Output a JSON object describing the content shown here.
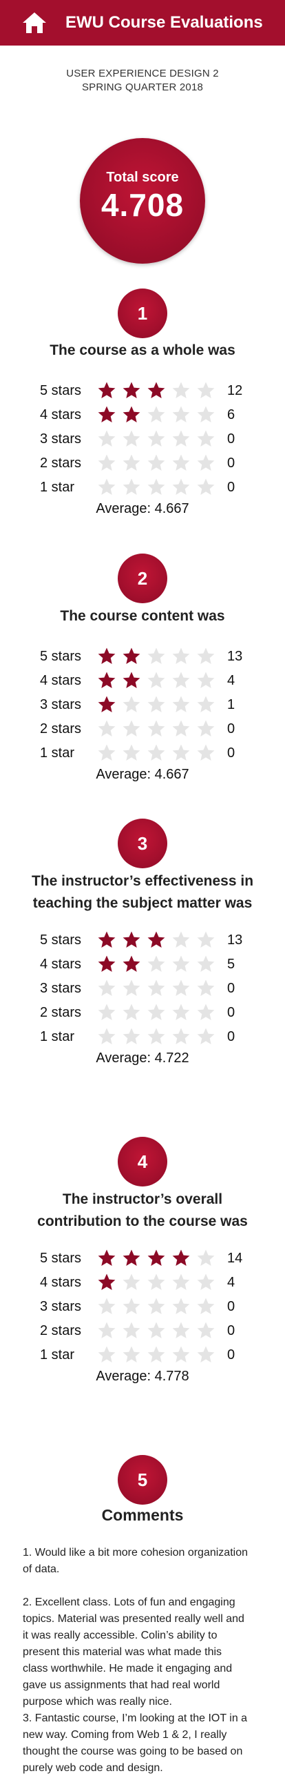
{
  "header": {
    "title": "EWU Course Evaluations",
    "color": "#a30f2d"
  },
  "course": {
    "name": "USER EXPERIENCE DESIGN 2",
    "term": "SPRING QUARTER 2018"
  },
  "total": {
    "label": "Total score",
    "value": "4.708"
  },
  "colors": {
    "star_filled": "#8c0a26",
    "star_empty": "#e4e4e4"
  },
  "questions": [
    {
      "number": "1",
      "title": "The course as a whole was",
      "ratings": [
        {
          "label": "5 stars",
          "count": "12",
          "filled": 3
        },
        {
          "label": "4 stars",
          "count": "6",
          "filled": 2
        },
        {
          "label": "3 stars",
          "count": "0",
          "filled": 0
        },
        {
          "label": "2 stars",
          "count": "0",
          "filled": 0
        },
        {
          "label": "1 star",
          "count": "0",
          "filled": 0
        }
      ],
      "average": "Average: 4.667"
    },
    {
      "number": "2",
      "title": "The course content was",
      "ratings": [
        {
          "label": "5 stars",
          "count": "13",
          "filled": 2
        },
        {
          "label": "4 stars",
          "count": "4",
          "filled": 2
        },
        {
          "label": "3 stars",
          "count": "1",
          "filled": 1
        },
        {
          "label": "2 stars",
          "count": "0",
          "filled": 0
        },
        {
          "label": "1 star",
          "count": "0",
          "filled": 0
        }
      ],
      "average": "Average: 4.667"
    },
    {
      "number": "3",
      "title_line1": "The instructor’s effectiveness in",
      "title_line2": "teaching the subject matter was",
      "ratings": [
        {
          "label": "5 stars",
          "count": "13",
          "filled": 3
        },
        {
          "label": "4 stars",
          "count": "5",
          "filled": 2
        },
        {
          "label": "3 stars",
          "count": "0",
          "filled": 0
        },
        {
          "label": "2 stars",
          "count": "0",
          "filled": 0
        },
        {
          "label": "1 star",
          "count": "0",
          "filled": 0
        }
      ],
      "average": "Average: 4.722"
    },
    {
      "number": "4",
      "title_line1": "The instructor’s overall",
      "title_line2": "contribution to the course was",
      "ratings": [
        {
          "label": "5 stars",
          "count": "14",
          "filled": 4
        },
        {
          "label": "4 stars",
          "count": "4",
          "filled": 1
        },
        {
          "label": "3 stars",
          "count": "0",
          "filled": 0
        },
        {
          "label": "2 stars",
          "count": "0",
          "filled": 0
        },
        {
          "label": "1 star",
          "count": "0",
          "filled": 0
        }
      ],
      "average": "Average: 4.778"
    }
  ],
  "comments": {
    "number": "5",
    "title": "Comments",
    "items": [
      {
        "lines": [
          "1. Would like a bit more cohesion organization",
          "of data."
        ]
      },
      {
        "lines": [
          "2. Excellent class. Lots of fun and engaging",
          "topics. Material was presented really well and",
          "it was really accessible. Colin’s ability to",
          "present this material was what made this",
          "class worthwhile. He made it engaging and",
          "gave us assignments that had real world",
          "purpose which was really nice."
        ]
      },
      {
        "lines": [
          "3. Fantastic course, I’m looking at the IOT in a",
          "new way. Coming from Web 1 & 2, I really",
          "thought the course was going to be based on",
          "purely web code and design."
        ]
      }
    ]
  }
}
